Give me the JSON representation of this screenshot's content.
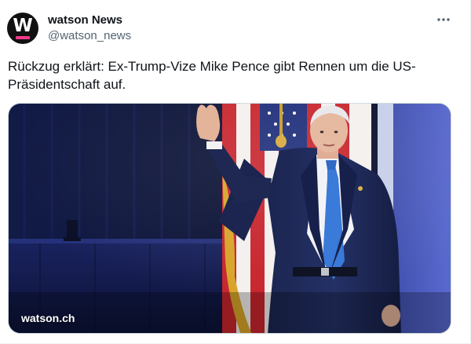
{
  "account": {
    "display_name": "watson News",
    "handle": "@watson_news",
    "avatar_letter": "W"
  },
  "tweet": {
    "text": "Rückzug erklärt: Ex-Trump-Vize Mike Pence gibt Rennen um die US-Präsidentschaft auf."
  },
  "media": {
    "caption": "watson.ch"
  },
  "icons": {
    "more": "more-horizontal-icon"
  },
  "colors": {
    "text": "#0f1419",
    "secondary": "#536471",
    "avatar_bg": "#111111",
    "avatar_accent": "#ff3a8c"
  }
}
